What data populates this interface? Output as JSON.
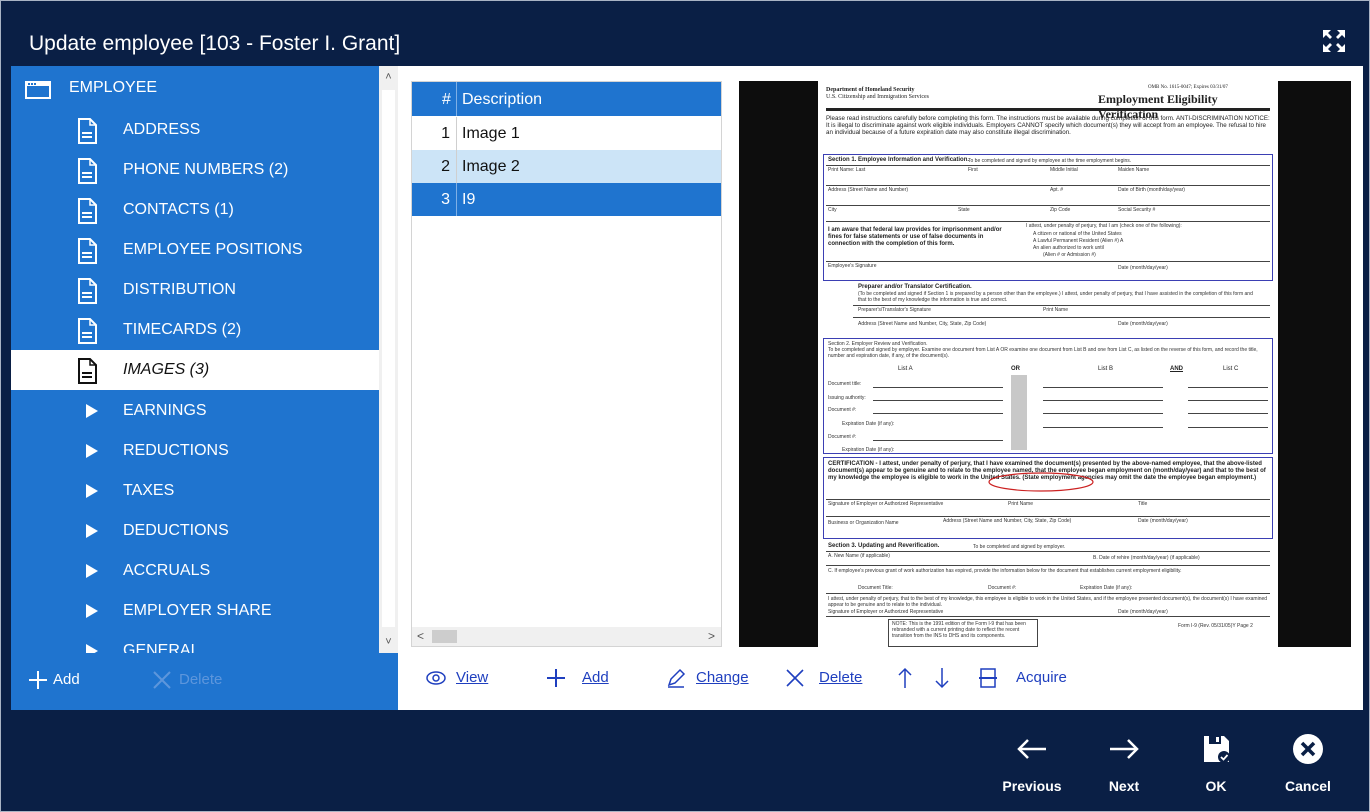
{
  "window": {
    "title": "Update employee [103 - Foster I. Grant]"
  },
  "sidebar": {
    "root": {
      "label": "EMPLOYEE",
      "icon": "window-icon"
    },
    "items": [
      {
        "label": "ADDRESS",
        "icon": "document-icon"
      },
      {
        "label": "PHONE NUMBERS (2)",
        "icon": "document-icon"
      },
      {
        "label": "CONTACTS (1)",
        "icon": "document-icon"
      },
      {
        "label": "EMPLOYEE POSITIONS",
        "icon": "document-icon"
      },
      {
        "label": "DISTRIBUTION",
        "icon": "document-icon"
      },
      {
        "label": "TIMECARDS (2)",
        "icon": "document-icon"
      },
      {
        "label": "IMAGES (3)",
        "icon": "document-icon",
        "selected": true
      },
      {
        "label": "EARNINGS",
        "icon": "expand-arrow-icon"
      },
      {
        "label": "REDUCTIONS",
        "icon": "expand-arrow-icon"
      },
      {
        "label": "TAXES",
        "icon": "expand-arrow-icon"
      },
      {
        "label": "DEDUCTIONS",
        "icon": "expand-arrow-icon"
      },
      {
        "label": "ACCRUALS",
        "icon": "expand-arrow-icon"
      },
      {
        "label": "EMPLOYER SHARE",
        "icon": "expand-arrow-icon"
      },
      {
        "label": "GENERAL",
        "icon": "expand-arrow-icon"
      }
    ],
    "footer": {
      "add_label": "Add",
      "delete_label": "Delete"
    }
  },
  "image_list": {
    "header": {
      "num": "#",
      "description": "Description"
    },
    "rows": [
      {
        "num": "1",
        "description": "Image 1"
      },
      {
        "num": "2",
        "description": "Image 2"
      },
      {
        "num": "3",
        "description": "I9"
      }
    ]
  },
  "preview": {
    "doc_header_left_1": "Department of Homeland Security",
    "doc_header_left_2": "U.S. Citizenship and Immigration Services",
    "doc_omb": "OMB No. 1615-0047; Expires 03/31/07",
    "doc_title": "Employment Eligibility Verification",
    "doc_intro": "Please read instructions carefully before completing this form. The instructions must be available during completion of this form. ANTI-DISCRIMINATION NOTICE: It is illegal to discriminate against work eligible individuals. Employers CANNOT specify which document(s) they will accept from an employee. The refusal to hire an individual because of a future expiration date may also constitute illegal discrimination.",
    "section1": "Section 1. Employee Information and Verification.",
    "section1_note": "To be completed and signed by employee at the time employment begins.",
    "s1_print_name": "Print Name:  Last",
    "s1_first": "First",
    "s1_middle": "Middle Initial",
    "s1_maiden": "Maiden Name",
    "s1_address": "Address (Street Name and Number)",
    "s1_apt": "Apt. #",
    "s1_dob": "Date of Birth (month/day/year)",
    "s1_city": "City",
    "s1_state": "State",
    "s1_zip": "Zip Code",
    "s1_ssn": "Social Security #",
    "s1_aware": "I am aware that federal law provides for imprisonment and/or fines for false statements or use of false documents in connection with the completion of this form.",
    "s1_attest": "I attest, under penalty of perjury, that I am (check one of the following):",
    "s1_opt1": "A citizen or national of the United States",
    "s1_opt2": "A Lawful Permanent Resident (Alien #) A",
    "s1_opt3": "An alien authorized to work until",
    "s1_opt3b": "(Alien # or Admission #)",
    "s1_sig": "Employee's Signature",
    "s1_date": "Date (month/day/year)",
    "preparer": "Preparer and/or Translator Certification.",
    "preparer_note": "(To be completed and signed if Section 1 is prepared by a person other than the employee.) I attest, under penalty of perjury, that I have assisted in the completion of this form and that to the best of my knowledge the information is true and correct.",
    "prep_sig": "Preparer's/Translator's Signature",
    "prep_name": "Print Name",
    "prep_addr": "Address (Street Name and Number, City, State, Zip Code)",
    "prep_date": "Date (month/day/year)",
    "section2": "Section 2. Employer Review and Verification.",
    "section2_note": "To be completed and signed by employer. Examine one document from List A OR examine one document from List B and one from List C, as listed on the reverse of this form, and record the title, number and expiration date, if any, of the document(s).",
    "list_a": "List A",
    "or": "OR",
    "list_b": "List B",
    "and": "AND",
    "list_c": "List C",
    "doc_title_lbl": "Document title:",
    "issuing": "Issuing authority:",
    "doc_num": "Document #:",
    "exp_date": "Expiration Date (if any):",
    "doc_num2": "Document #:",
    "exp_date2": "Expiration Date (if any):",
    "certification": "CERTIFICATION - I attest, under penalty of perjury, that I have examined the document(s) presented by the above-named employee, that the above-listed document(s) appear to be genuine and to relate to the employee named, that the employee began employment on (month/day/year) and that to the best of my knowledge the employee is eligible to work in the United States. (State employment agencies may omit the date the employee began employment.)",
    "cert_sig": "Signature of Employer or Authorized Representative",
    "cert_name": "Print Name",
    "cert_title": "Title",
    "cert_biz": "Business or Organization Name",
    "cert_addr": "Address (Street Name and Number, City, State, Zip Code)",
    "cert_date": "Date (month/day/year)",
    "section3": "Section 3. Updating and Reverification.",
    "section3_note": "To be completed and signed by employer.",
    "s3_a": "A. New Name (if applicable)",
    "s3_b": "B. Date of rehire (month/day/year) (if applicable)",
    "s3_c": "C. If employee's previous grant of work authorization has expired, provide the information below for the document that establishes current employment eligibility.",
    "s3_doc_title": "Document Title:",
    "s3_doc_num": "Document #:",
    "s3_exp": "Expiration Date (if any):",
    "s3_attest": "I attest, under penalty of perjury, that to the best of my knowledge, this employee is eligible to work in the United States, and if the employee presented document(s), the document(s) I have examined appear to be genuine and to relate to the individual.",
    "s3_sig": "Signature of Employer or Authorized Representative",
    "s3_date": "Date (month/day/year)",
    "note": "NOTE: This is the 1991 edition of the Form I-9 that has been rebranded with a current printing date to reflect the recent transition from the INS to DHS and its components.",
    "form_num": "Form I-9 (Rev. 05/31/05)Y Page 2"
  },
  "actions": {
    "view": "View",
    "add": "Add",
    "change": "Change",
    "delete": "Delete",
    "acquire": "Acquire"
  },
  "footer": {
    "previous": "Previous",
    "next": "Next",
    "ok": "OK",
    "cancel": "Cancel"
  }
}
